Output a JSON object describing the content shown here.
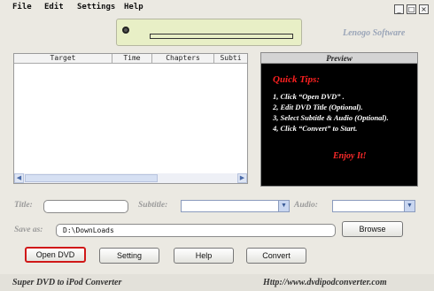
{
  "menu": {
    "file": "File",
    "edit": "Edit",
    "settings": "Settings",
    "help": "Help"
  },
  "window_controls": {
    "minimize": "_",
    "maximize": "□",
    "close": "×"
  },
  "brand": "Lenogo Software",
  "filelist": {
    "columns": [
      "Target",
      "Time",
      "Chapters",
      "Subti"
    ]
  },
  "preview": {
    "title": "Preview",
    "heading": "Quick Tips:",
    "tips": [
      "1, Click “Open DVD” .",
      "2, Edit DVD Title (Optional).",
      "3, Select Subtitle & Audio (Optional).",
      "4, Click “Convert” to Start."
    ],
    "enjoy": "Enjoy It!"
  },
  "form": {
    "title_label": "Title:",
    "title_value": "",
    "subtitle_label": "Subtitle:",
    "subtitle_value": "",
    "audio_label": "Audio:",
    "audio_value": "",
    "saveas_label": "Save as:",
    "saveas_value": "D:\\DownLoads",
    "browse_label": "Browse"
  },
  "buttons": {
    "open_dvd": "Open DVD",
    "setting": "Setting",
    "help": "Help",
    "convert": "Convert"
  },
  "footer": {
    "product": "Super DVD to iPod Converter",
    "url": "Http://www.dvdipodconverter.com"
  },
  "icons": [
    "disc-icon",
    "chevron-down-icon",
    "arrow-left-icon",
    "arrow-right-icon"
  ]
}
